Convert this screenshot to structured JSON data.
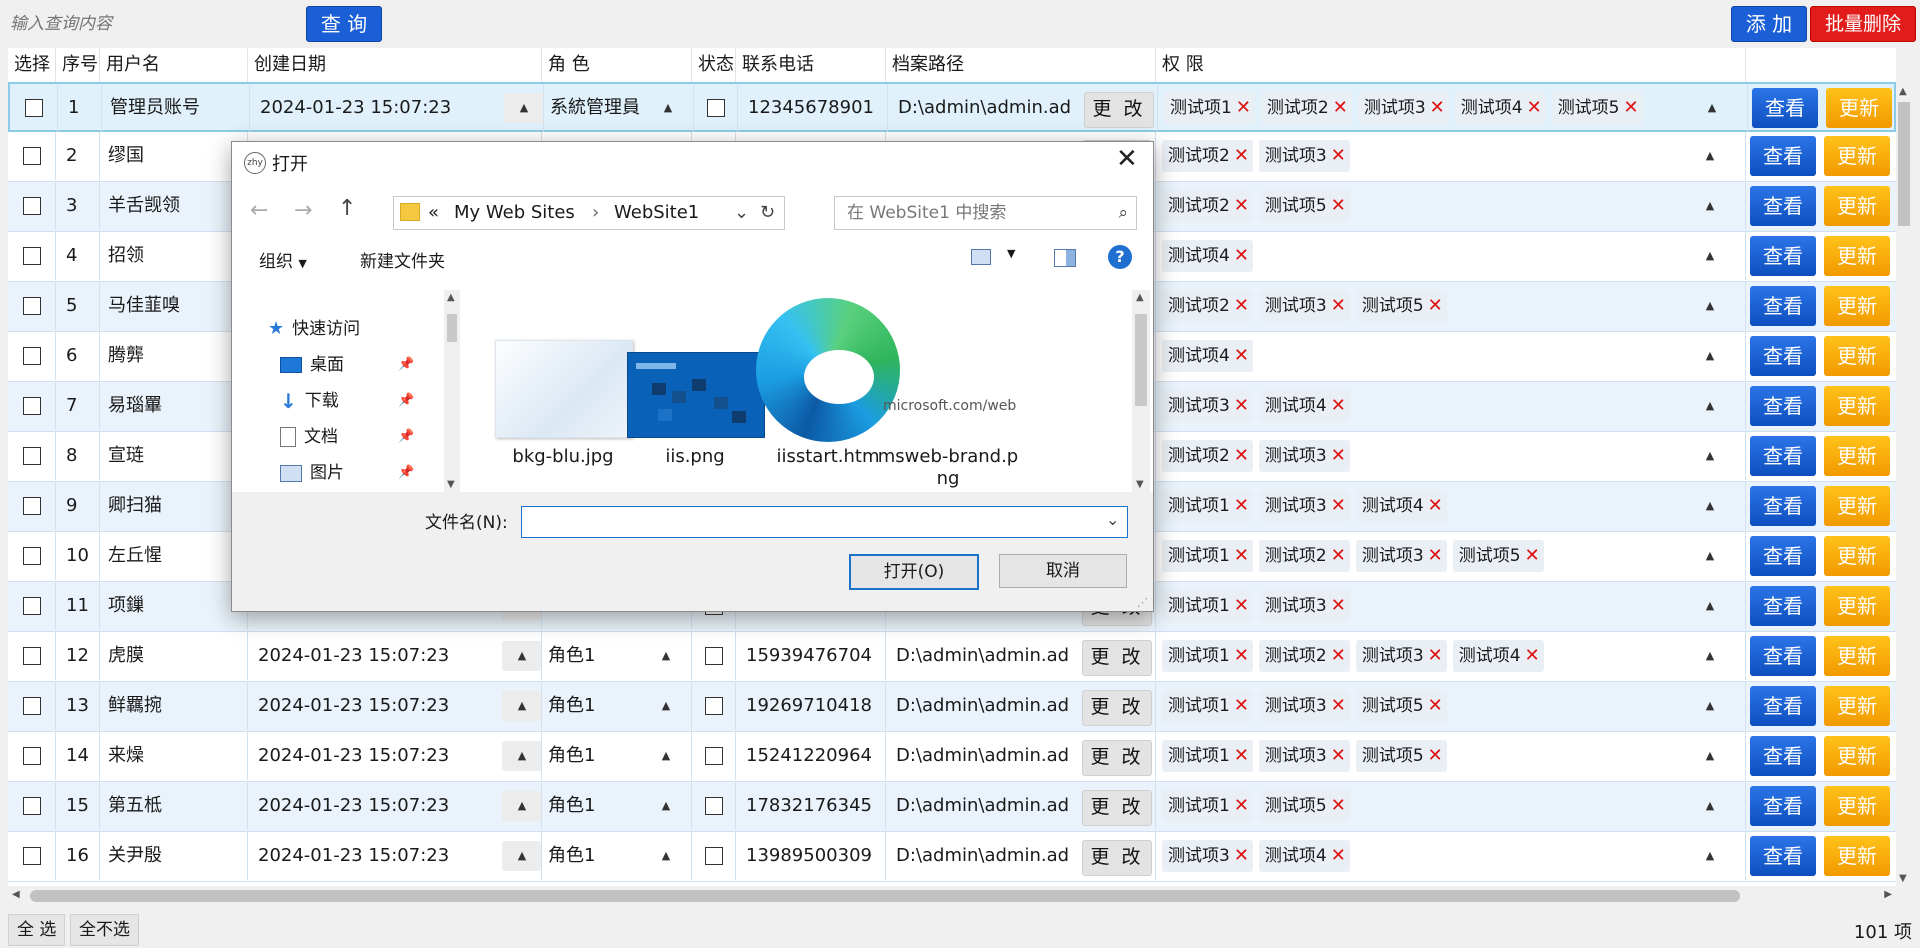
{
  "search": {
    "placeholder": "输入查询内容",
    "query_label": "查 询"
  },
  "toolbar": {
    "add_label": "添 加",
    "batch_delete_label": "批量删除"
  },
  "columns": [
    "选择",
    "序号",
    "用户名",
    "创建日期",
    "角 色",
    "状态",
    "联系电话",
    "档案路径",
    "权 限"
  ],
  "row_action": {
    "change_label": "更 改",
    "view_label": "查看",
    "update_label": "更新"
  },
  "rows": [
    {
      "no": "1",
      "name": "管理员账号",
      "date": "2024-01-23 15:07:23",
      "role": "系統管理員",
      "phone": "12345678901",
      "path": "D:\\admin\\admin.ad",
      "perms": [
        "测试项1",
        "测试项2",
        "测试项3",
        "测试项4",
        "测试项5"
      ]
    },
    {
      "no": "2",
      "name": "缪国",
      "date": "",
      "role": "",
      "phone": "",
      "path": "",
      "perms": [
        "测试项2",
        "测试项3"
      ]
    },
    {
      "no": "3",
      "name": "羊舌觊领",
      "date": "",
      "role": "",
      "phone": "",
      "path": "",
      "perms": [
        "测试项2",
        "测试项5"
      ]
    },
    {
      "no": "4",
      "name": "招领",
      "date": "",
      "role": "",
      "phone": "",
      "path": "",
      "perms": [
        "测试项4"
      ]
    },
    {
      "no": "5",
      "name": "马佳韮嗅",
      "date": "",
      "role": "",
      "phone": "",
      "path": "",
      "perms": [
        "测试项2",
        "测试项3",
        "测试项5"
      ]
    },
    {
      "no": "6",
      "name": "腾龏",
      "date": "",
      "role": "",
      "phone": "",
      "path": "",
      "perms": [
        "测试项4"
      ]
    },
    {
      "no": "7",
      "name": "易瑙罼",
      "date": "",
      "role": "",
      "phone": "",
      "path": "",
      "perms": [
        "测试项3",
        "测试项4"
      ]
    },
    {
      "no": "8",
      "name": "宣琏",
      "date": "",
      "role": "",
      "phone": "",
      "path": "",
      "perms": [
        "测试项2",
        "测试项3"
      ]
    },
    {
      "no": "9",
      "name": "卿扫猫",
      "date": "",
      "role": "",
      "phone": "",
      "path": "",
      "perms": [
        "测试项1",
        "测试项3",
        "测试项4"
      ]
    },
    {
      "no": "10",
      "name": "左丘惺",
      "date": "",
      "role": "",
      "phone": "",
      "path": "",
      "perms": [
        "测试项1",
        "测试项2",
        "测试项3",
        "测试项5"
      ]
    },
    {
      "no": "11",
      "name": "项鏁",
      "date": "",
      "role": "",
      "phone": "",
      "path": "",
      "perms": [
        "测试项1",
        "测试项3"
      ]
    },
    {
      "no": "12",
      "name": "虎膜",
      "date": "2024-01-23 15:07:23",
      "role": "角色1",
      "phone": "15939476704",
      "path": "D:\\admin\\admin.ad",
      "perms": [
        "测试项1",
        "测试项2",
        "测试项3",
        "测试项4"
      ]
    },
    {
      "no": "13",
      "name": "鲜羈捥",
      "date": "2024-01-23 15:07:23",
      "role": "角色1",
      "phone": "19269710418",
      "path": "D:\\admin\\admin.ad",
      "perms": [
        "测试项1",
        "测试项3",
        "测试项5"
      ]
    },
    {
      "no": "14",
      "name": "来燥",
      "date": "2024-01-23 15:07:23",
      "role": "角色1",
      "phone": "15241220964",
      "path": "D:\\admin\\admin.ad",
      "perms": [
        "测试项1",
        "测试项3",
        "测试项5"
      ]
    },
    {
      "no": "15",
      "name": "第五柢",
      "date": "2024-01-23 15:07:23",
      "role": "角色1",
      "phone": "17832176345",
      "path": "D:\\admin\\admin.ad",
      "perms": [
        "测试项1",
        "测试项5"
      ]
    },
    {
      "no": "16",
      "name": "关尹殷",
      "date": "2024-01-23 15:07:23",
      "role": "角色1",
      "phone": "13989500309",
      "path": "D:\\admin\\admin.ad",
      "perms": [
        "测试项3",
        "测试项4"
      ]
    }
  ],
  "footer": {
    "select_all": "全 选",
    "select_none": "全不选",
    "count": "101 项"
  },
  "dialog": {
    "title": "打开",
    "crumb_prefix": "«",
    "crumb_1": "My Web Sites",
    "crumb_2": "WebSite1",
    "search_placeholder": "在 WebSite1 中搜索",
    "organize": "组织",
    "new_folder": "新建文件夹",
    "tree": [
      {
        "label": "快速访问",
        "icon": "star-icon"
      },
      {
        "label": "桌面",
        "icon": "desktop-icon"
      },
      {
        "label": "下载",
        "icon": "download-icon"
      },
      {
        "label": "文档",
        "icon": "document-icon"
      },
      {
        "label": "图片",
        "icon": "picture-icon"
      }
    ],
    "files": [
      "bkg-blu.jpg",
      "iis.png",
      "iisstart.htm",
      "msweb-brand.png"
    ],
    "brand_thumb_text": "microsoft.com/web",
    "filename_label": "文件名(N):",
    "filename_value": "",
    "open_label": "打开(O)",
    "cancel_label": "取消"
  },
  "colors": {
    "accent_blue": "#1a5fd6",
    "danger_red": "#e21b1b",
    "update_orange": "#f5a300",
    "tag_x": "#e01010"
  }
}
